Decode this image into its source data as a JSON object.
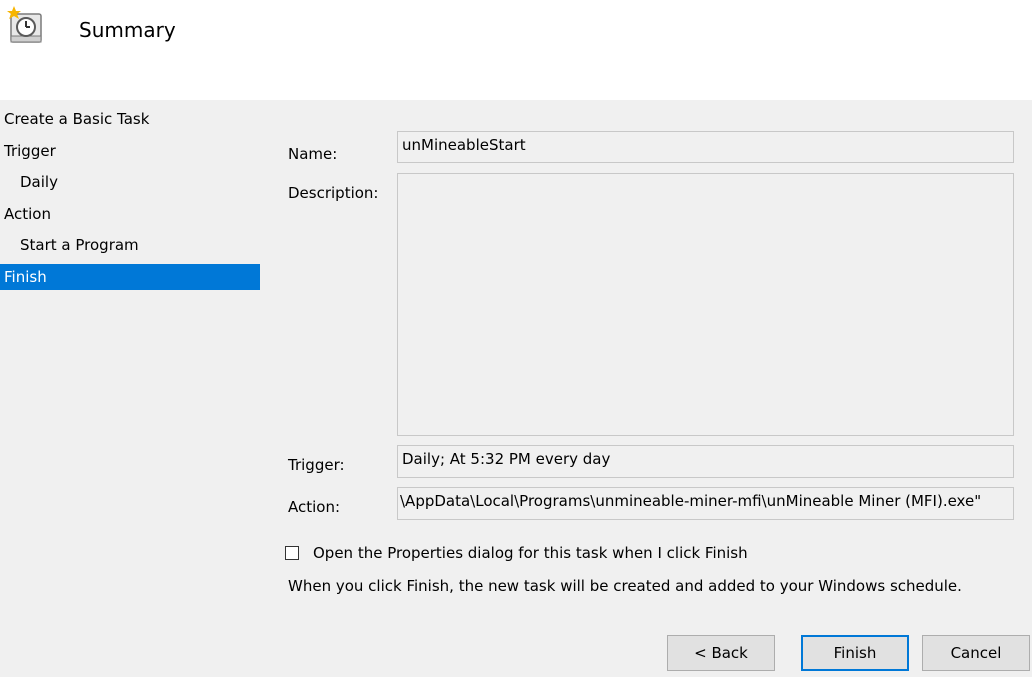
{
  "header": {
    "title": "Summary",
    "icon": "task-scheduler-clock-icon"
  },
  "steps": [
    {
      "label": "Create a Basic Task",
      "level": 1,
      "active": false
    },
    {
      "label": "Trigger",
      "level": 1,
      "active": false
    },
    {
      "label": "Daily",
      "level": 2,
      "active": false
    },
    {
      "label": "Action",
      "level": 1,
      "active": false
    },
    {
      "label": "Start a Program",
      "level": 2,
      "active": false
    },
    {
      "label": "Finish",
      "level": 1,
      "active": true
    }
  ],
  "fields": {
    "name_label": "Name:",
    "name_value": "unMineableStart",
    "description_label": "Description:",
    "description_value": "",
    "trigger_label": "Trigger:",
    "trigger_value": "Daily; At 5:32 PM every day",
    "action_label": "Action:",
    "action_value": "\\AppData\\Local\\Programs\\unmineable-miner-mfi\\unMineable Miner (MFI).exe\""
  },
  "options": {
    "open_properties_label": "Open the Properties dialog for this task when I click Finish",
    "open_properties_checked": false
  },
  "note": "When you click Finish, the new task will be created and added to your Windows schedule.",
  "buttons": {
    "back": "< Back",
    "finish": "Finish",
    "cancel": "Cancel"
  },
  "colors": {
    "selection": "#0078d7",
    "panel_background": "#f0f0f0",
    "header_background": "#ffffff"
  }
}
